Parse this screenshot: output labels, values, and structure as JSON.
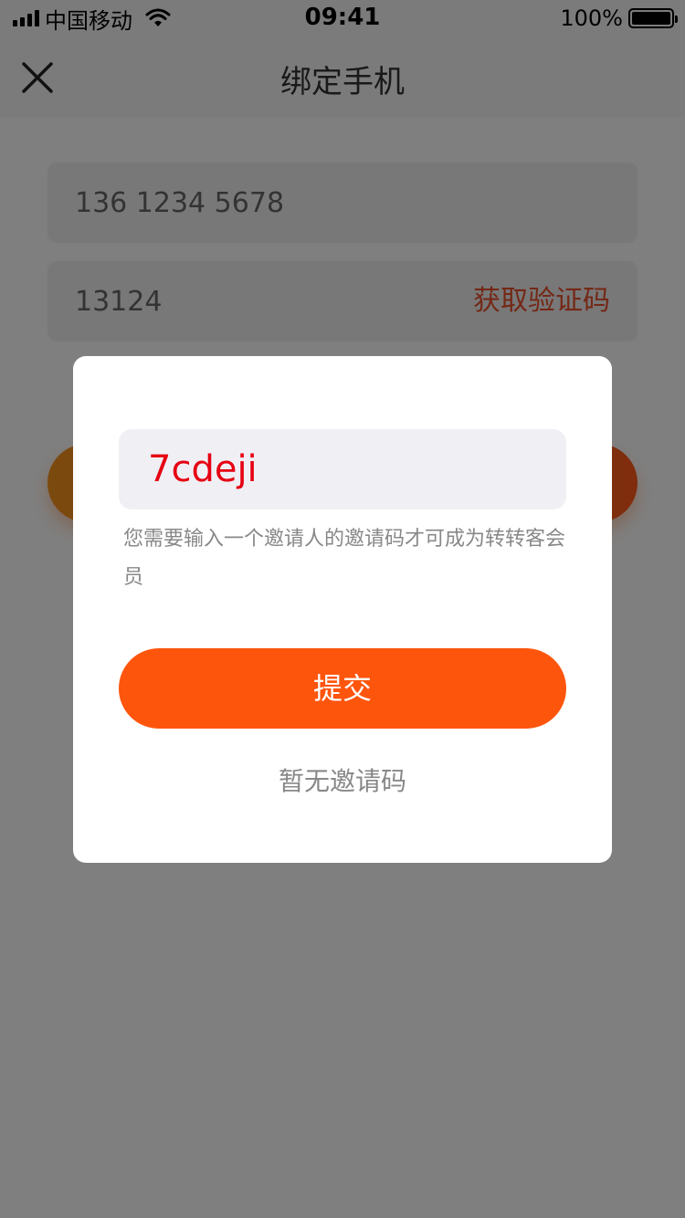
{
  "status_bar": {
    "carrier": "中国移动",
    "time": "09:41",
    "battery": "100%",
    "icons": [
      "signal-icon",
      "wifi-icon",
      "battery-icon"
    ]
  },
  "nav": {
    "title": "绑定手机",
    "close_icon": "close-icon"
  },
  "form": {
    "phone_value": "136 1234 5678",
    "code_value": "13124",
    "get_code_label": "获取验证码"
  },
  "modal": {
    "invite_code_value": "7cdeji",
    "hint": "您需要输入一个邀请人的邀请码才可成为转转客会员",
    "submit_label": "提交",
    "no_code_label": "暂无邀请码"
  },
  "colors": {
    "accent": "#fe550d",
    "get_code": "#e8502a",
    "invite_text": "#e60012"
  }
}
